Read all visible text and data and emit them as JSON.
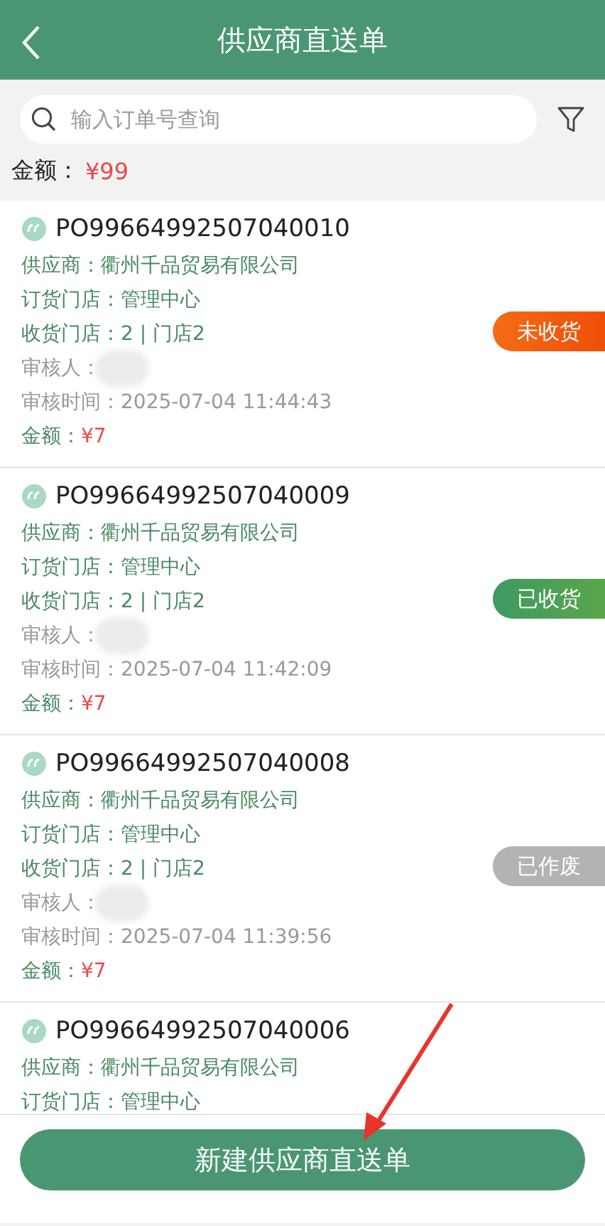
{
  "header": {
    "title": "供应商直送单"
  },
  "search": {
    "placeholder": "输入订单号查询"
  },
  "total": {
    "label": "金额：",
    "value": "¥99"
  },
  "orders": [
    {
      "number": "PO99664992507040010",
      "supplier": "供应商：衢州千品贸易有限公司",
      "order_store": "订货门店：管理中心",
      "receive_store": "收货门店：2 | 门店2",
      "reviewer": "审核人：",
      "review_time": "审核时间：2025-07-04 11:44:43",
      "amount_label": "金额：",
      "amount": "¥7",
      "status": {
        "kind": "pending",
        "label": "未收货"
      }
    },
    {
      "number": "PO99664992507040009",
      "supplier": "供应商：衢州千品贸易有限公司",
      "order_store": "订货门店：管理中心",
      "receive_store": "收货门店：2 | 门店2",
      "reviewer": "审核人：",
      "review_time": "审核时间：2025-07-04 11:42:09",
      "amount_label": "金额：",
      "amount": "¥7",
      "status": {
        "kind": "received",
        "label": "已收货"
      }
    },
    {
      "number": "PO99664992507040008",
      "supplier": "供应商：衢州千品贸易有限公司",
      "order_store": "订货门店：管理中心",
      "receive_store": "收货门店：2 | 门店2",
      "reviewer": "审核人：",
      "review_time": "审核时间：2025-07-04 11:39:56",
      "amount_label": "金额：",
      "amount": "¥7",
      "status": {
        "kind": "voided",
        "label": "已作废"
      }
    },
    {
      "number": "PO99664992507040006",
      "supplier": "供应商：衢州千品贸易有限公司",
      "order_store": "订货门店：管理中心"
    }
  ],
  "create_button": "新建供应商直送单"
}
